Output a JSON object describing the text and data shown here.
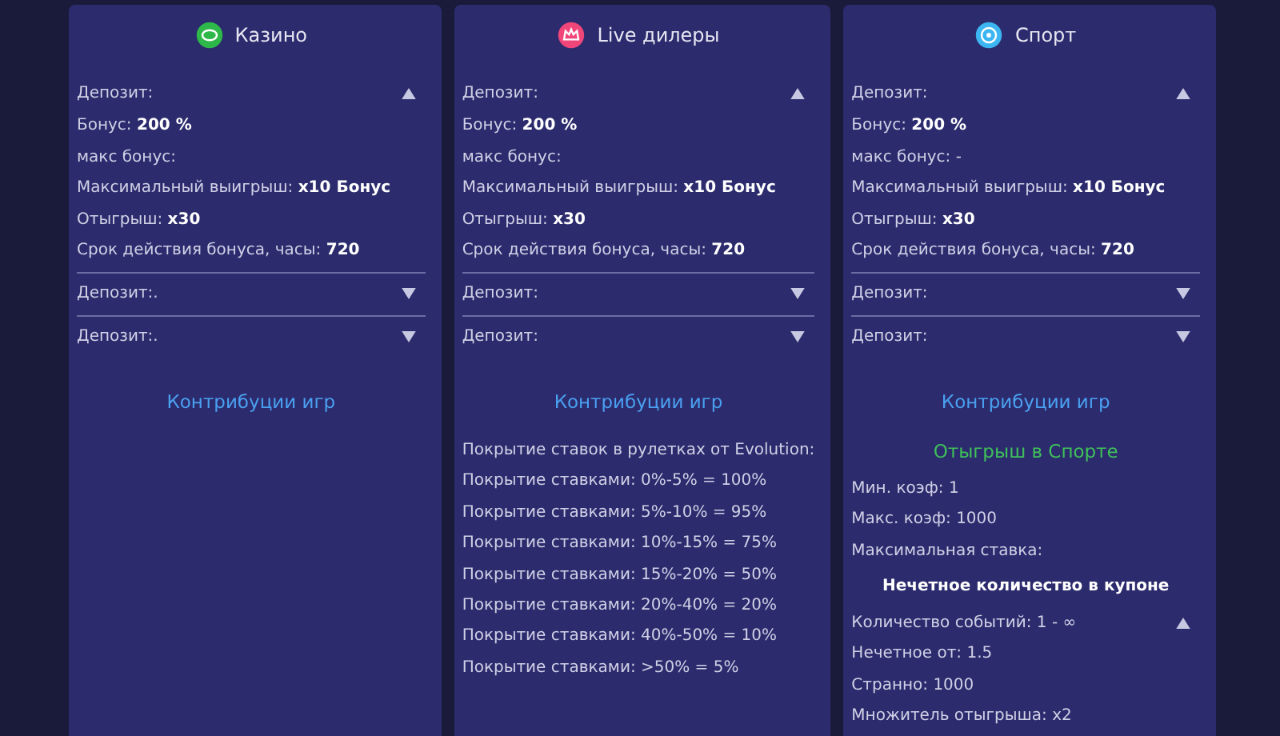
{
  "cards": [
    {
      "title": "Казино",
      "kind": "casino",
      "accordions": [
        {
          "label": "Депозит:",
          "expanded": true,
          "rows": [
            "Бонус: **200 %**",
            "макс бонус:",
            "Максимальный выигрыш: **x10 Бонус**",
            "Отыгрыш: **x30**",
            "Срок действия бонуса, часы: **720**"
          ]
        },
        {
          "label": "Депозит:.",
          "expanded": false
        },
        {
          "label": "Депозит:.",
          "expanded": false
        }
      ],
      "link": "Контрибуции игр"
    },
    {
      "title": "Live дилеры",
      "kind": "live",
      "accordions": [
        {
          "label": "Депозит:",
          "expanded": true,
          "rows": [
            "Бонус: **200 %**",
            "макс бонус:",
            "Максимальный выигрыш: **x10 Бонус**",
            "Отыгрыш: **x30**",
            "Срок действия бонуса, часы: **720**"
          ]
        },
        {
          "label": "Депозит:",
          "expanded": false
        },
        {
          "label": "Депозит:",
          "expanded": false
        }
      ],
      "link": "Контрибуции игр",
      "extra": [
        {
          "kind": "note",
          "text": "Покрытие ставок в рулетках от Evolution:"
        },
        {
          "kind": "note",
          "text": "Покрытие ставками: 0%-5% = 100%"
        },
        {
          "kind": "note",
          "text": "Покрытие ставками: 5%-10% = 95%"
        },
        {
          "kind": "note",
          "text": "Покрытие ставками: 10%-15% = 75%"
        },
        {
          "kind": "note",
          "text": "Покрытие ставками: 15%-20% = 50%"
        },
        {
          "kind": "note",
          "text": "Покрытие ставками: 20%-40% = 20%"
        },
        {
          "kind": "note",
          "text": "Покрытие ставками: 40%-50% = 10%"
        },
        {
          "kind": "note",
          "text": "Покрытие ставками: >50% = 5%"
        }
      ]
    },
    {
      "title": "Спорт",
      "kind": "sport",
      "accordions": [
        {
          "label": "Депозит:",
          "expanded": true,
          "rows": [
            "Бонус: **200 %**",
            "макс бонус: -",
            "Максимальный выигрыш: **x10 Бонус**",
            "Отыгрыш: **x30**",
            "Срок действия бонуса, часы: **720**"
          ]
        },
        {
          "label": "Депозит:",
          "expanded": false
        },
        {
          "label": "Депозит:",
          "expanded": false
        }
      ],
      "link": "Контрибуции игр",
      "extra": [
        {
          "kind": "green-title",
          "text": "Отыгрыш в Спорте"
        },
        {
          "kind": "note",
          "text": "Мин. коэф: 1"
        },
        {
          "kind": "note",
          "text": "Макс. коэф: 1000"
        },
        {
          "kind": "note",
          "text": "Максимальная ставка:"
        },
        {
          "kind": "bold-title",
          "text": "Нечетное количество в купоне"
        },
        {
          "kind": "toggle",
          "text": "Количество событий: 1 - ∞",
          "expanded": true
        },
        {
          "kind": "note",
          "text": "Нечетное от: 1.5"
        },
        {
          "kind": "note",
          "text": "Странно: 1000"
        },
        {
          "kind": "note",
          "text": "Множитель отыгрыша: x2"
        }
      ]
    }
  ]
}
